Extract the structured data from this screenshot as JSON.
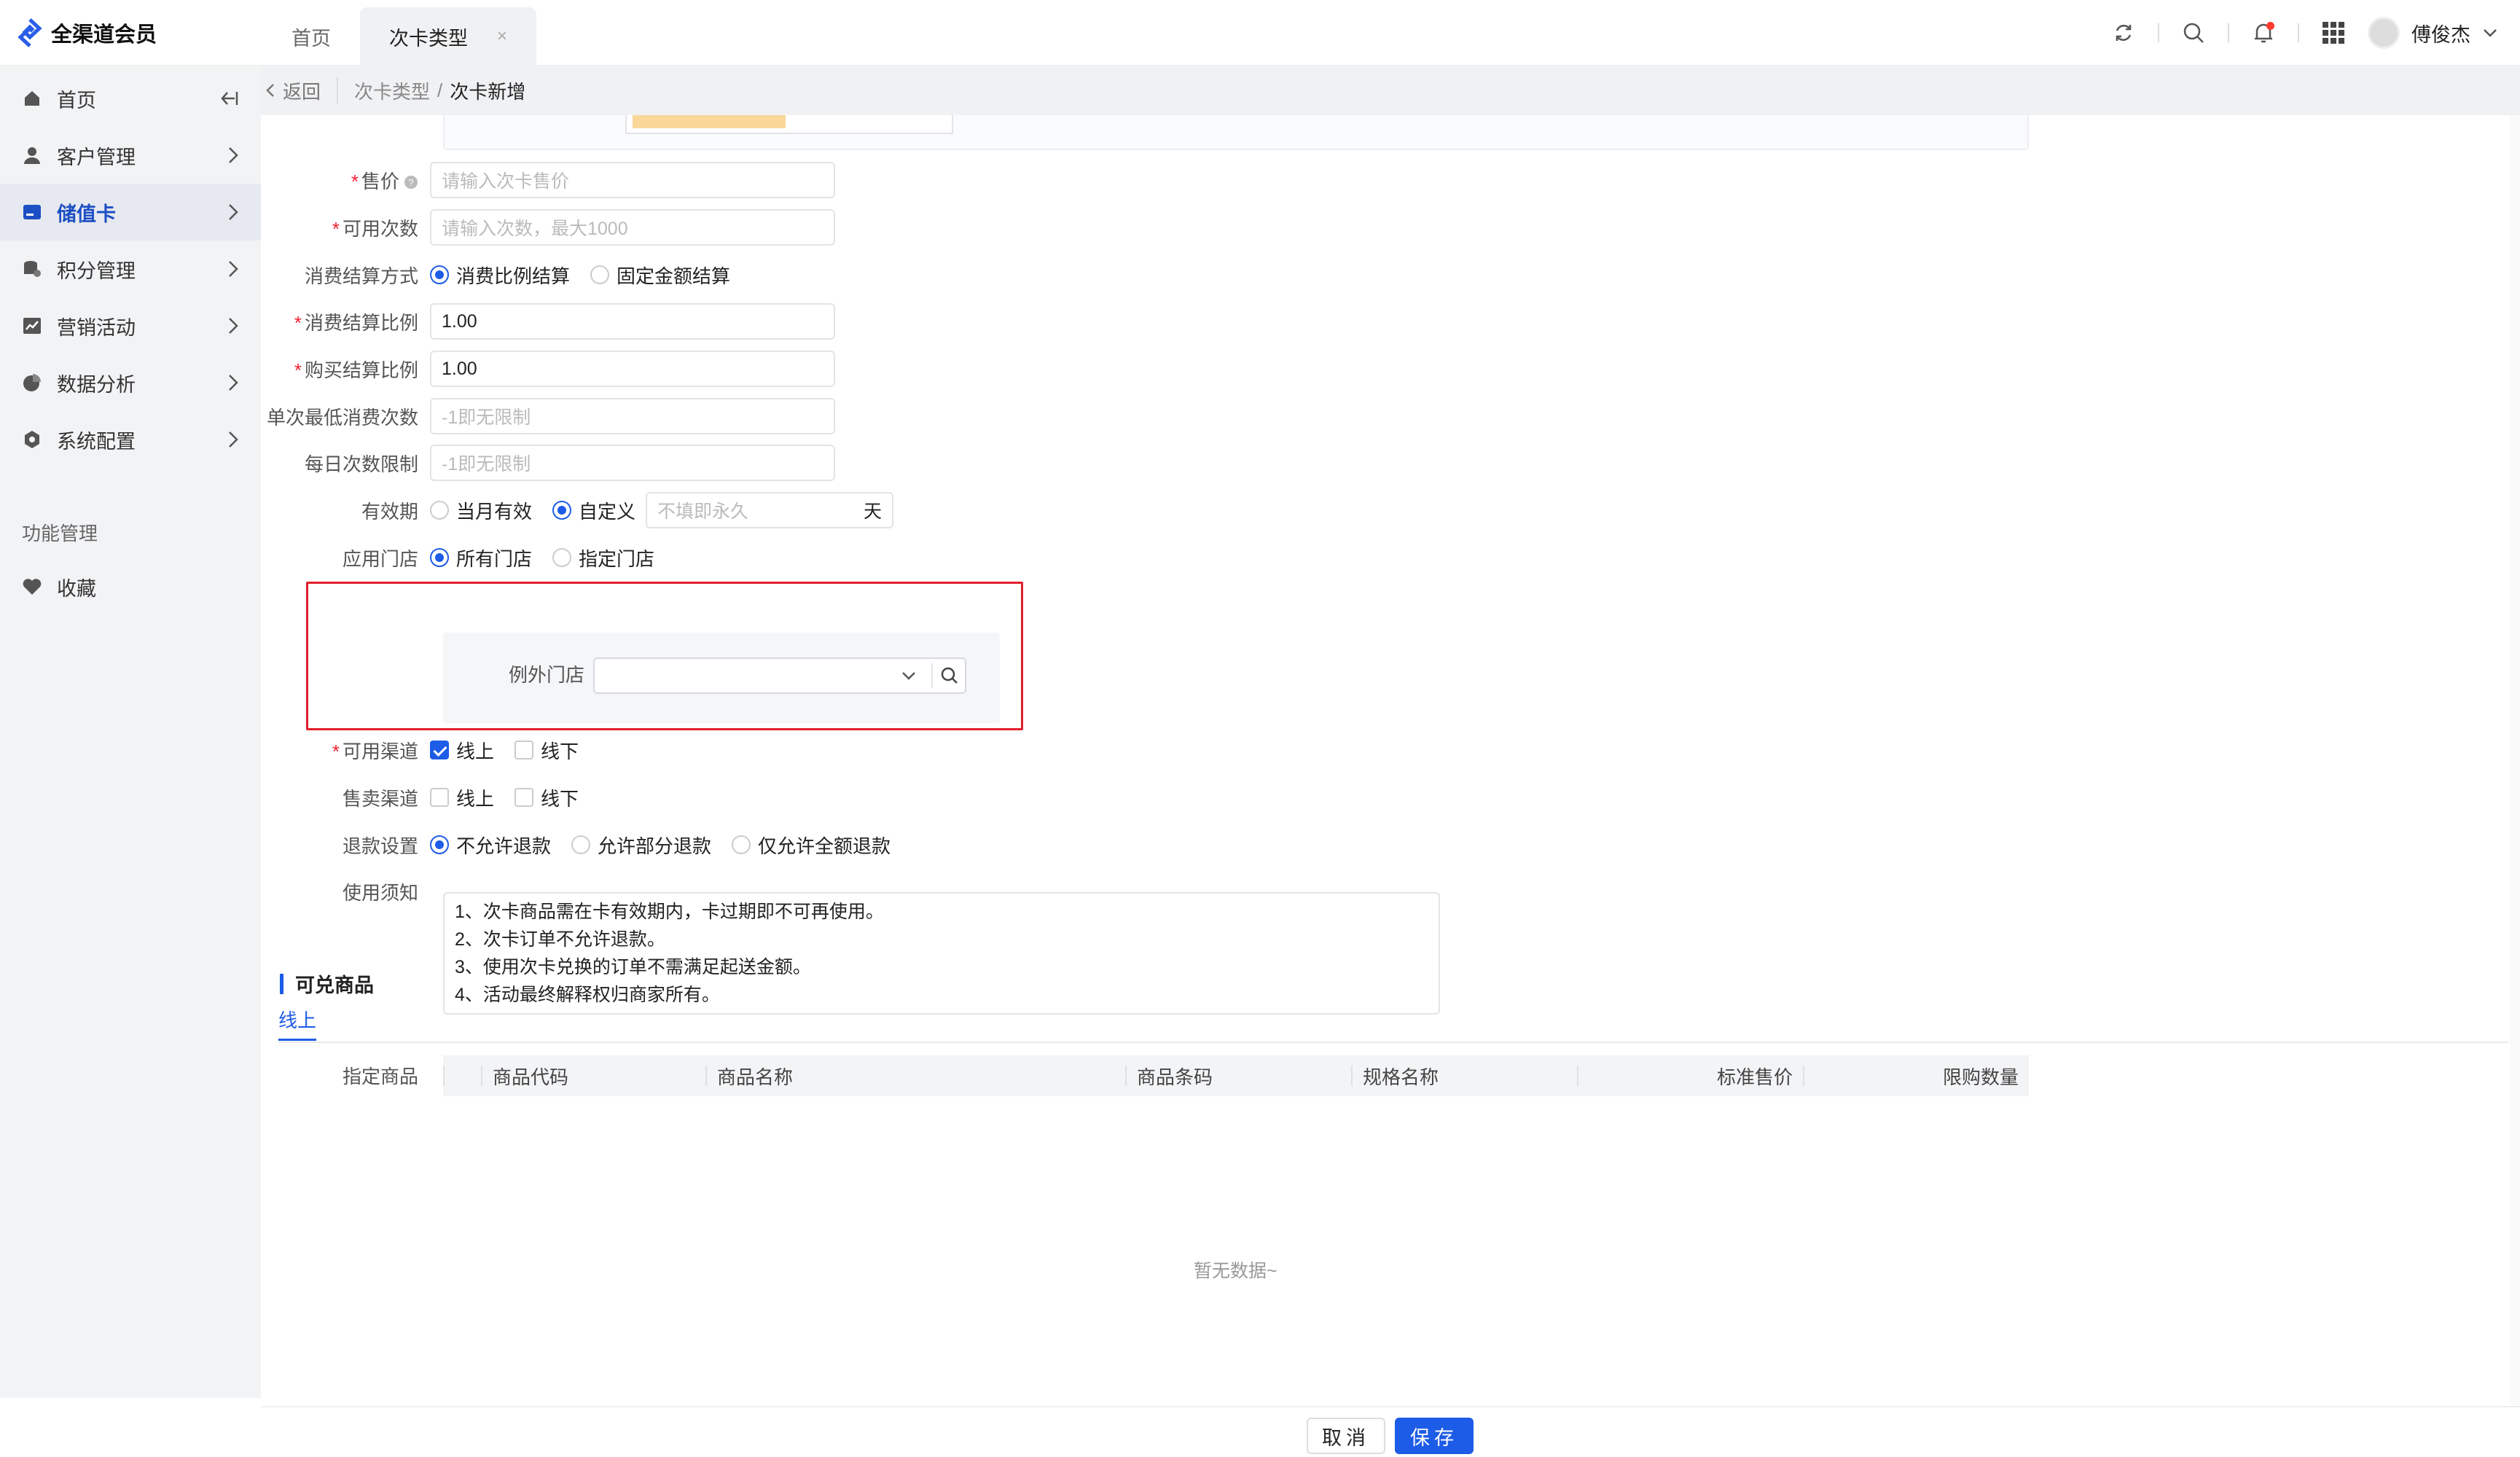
{
  "app": {
    "name": "全渠道会员"
  },
  "tabs": [
    {
      "label": "首页"
    },
    {
      "label": "次卡类型",
      "close": "×"
    }
  ],
  "user": {
    "name": "傅俊杰"
  },
  "sidebar": {
    "items": [
      {
        "label": "首页"
      },
      {
        "label": "客户管理"
      },
      {
        "label": "储值卡"
      },
      {
        "label": "积分管理"
      },
      {
        "label": "营销活动"
      },
      {
        "label": "数据分析"
      },
      {
        "label": "系统配置"
      }
    ],
    "section": "功能管理",
    "favorites": "收藏"
  },
  "breadcrumb": {
    "back": "返回",
    "parent": "次卡类型",
    "sep": "/",
    "current": "次卡新增"
  },
  "form": {
    "price": {
      "label": "售价",
      "placeholder": "请输入次卡售价"
    },
    "count": {
      "label": "可用次数",
      "placeholder": "请输入次数，最大1000"
    },
    "settle_method": {
      "label": "消费结算方式",
      "options": [
        "消费比例结算",
        "固定金额结算"
      ],
      "selected": "消费比例结算"
    },
    "consume_ratio": {
      "label": "消费结算比例",
      "value": "1.00"
    },
    "buy_ratio": {
      "label": "购买结算比例",
      "value": "1.00"
    },
    "min_consume": {
      "label": "单次最低消费次数",
      "placeholder": "-1即无限制"
    },
    "daily_limit": {
      "label": "每日次数限制",
      "placeholder": "-1即无限制"
    },
    "validity": {
      "label": "有效期",
      "options": [
        "当月有效",
        "自定义"
      ],
      "selected": "自定义",
      "placeholder": "不填即永久",
      "unit": "天"
    },
    "stores": {
      "label": "应用门店",
      "options": [
        "所有门店",
        "指定门店"
      ],
      "selected": "所有门店",
      "exception_label": "例外门店"
    },
    "channels": {
      "label": "可用渠道",
      "options": [
        "线上",
        "线下"
      ],
      "checked": [
        "线上"
      ]
    },
    "sale_channels": {
      "label": "售卖渠道",
      "options": [
        "线上",
        "线下"
      ],
      "checked": []
    },
    "refund": {
      "label": "退款设置",
      "options": [
        "不允许退款",
        "允许部分退款",
        "仅允许全额退款"
      ],
      "selected": "不允许退款"
    },
    "notes": {
      "label": "使用须知",
      "lines": [
        "1、次卡商品需在卡有效期内，卡过期即不可再使用。",
        "2、次卡订单不允许退款。",
        "3、使用次卡兑换的订单不需满足起送金额。",
        "4、活动最终解释权归商家所有。"
      ]
    }
  },
  "products": {
    "section_title": "可兑商品",
    "tab": "线上",
    "label": "指定商品",
    "columns": [
      "商品代码",
      "商品名称",
      "商品条码",
      "规格名称",
      "标准售价",
      "限购数量"
    ],
    "empty": "暂无数据~"
  },
  "footer": {
    "cancel": "取消",
    "save": "保存"
  },
  "colors": {
    "primary": "#1d5ce6",
    "highlight": "#e0202c"
  }
}
